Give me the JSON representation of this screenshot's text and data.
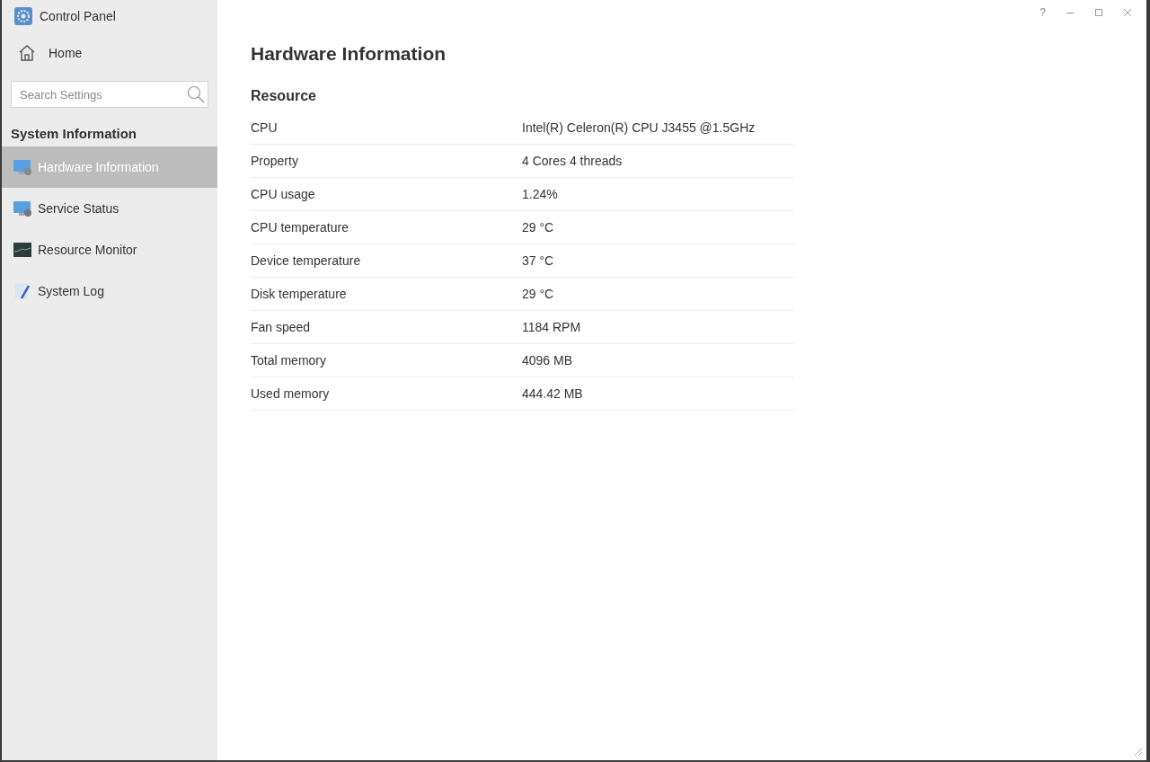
{
  "app": {
    "title": "Control Panel"
  },
  "home": {
    "label": "Home"
  },
  "search": {
    "placeholder": "Search Settings"
  },
  "sidebar": {
    "section": "System Information",
    "items": [
      {
        "label": "Hardware Information",
        "kind": "hardware",
        "selected": true
      },
      {
        "label": "Service Status",
        "kind": "service",
        "selected": false
      },
      {
        "label": "Resource Monitor",
        "kind": "monitor",
        "selected": false
      },
      {
        "label": "System Log",
        "kind": "log",
        "selected": false
      }
    ]
  },
  "window_controls": {
    "help": "?"
  },
  "main": {
    "title": "Hardware Information",
    "section": "Resource",
    "rows": [
      {
        "label": "CPU",
        "value": "Intel(R) Celeron(R) CPU J3455 @1.5GHz"
      },
      {
        "label": "Property",
        "value": "4 Cores 4 threads"
      },
      {
        "label": "CPU usage",
        "value": "1.24%"
      },
      {
        "label": "CPU temperature",
        "value": "29 °C"
      },
      {
        "label": "Device temperature",
        "value": "37 °C"
      },
      {
        "label": "Disk temperature",
        "value": "29 °C"
      },
      {
        "label": "Fan speed",
        "value": "1184 RPM"
      },
      {
        "label": "Total memory",
        "value": "4096 MB"
      },
      {
        "label": "Used memory",
        "value": "444.42 MB"
      }
    ]
  }
}
